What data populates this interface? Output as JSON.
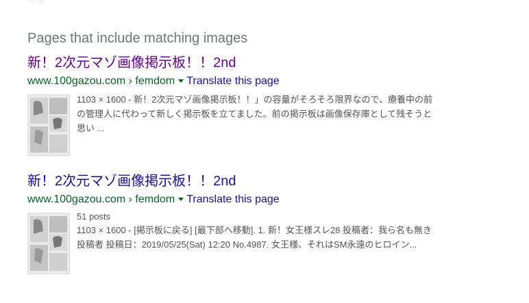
{
  "top_fragment": "... ...",
  "section_title": "Pages that include matching images",
  "results": [
    {
      "title": "新！2次元マゾ画像掲示板！！2nd",
      "url": "www.100gazou.com › femdom",
      "translate": "Translate this page",
      "posts": "",
      "snippet": "1103 × 1600 - 新！2次元マゾ画像掲示板！！」の容量がそろそろ限界なので、療養中の前の管理人に代わって新しく掲示板を立てました。前の掲示板は画像保存庫として残そうと思い ..."
    },
    {
      "title": "新！2次元マゾ画像掲示板！！2nd",
      "url": "www.100gazou.com › femdom",
      "translate": "Translate this page",
      "posts": "51 posts",
      "snippet": "1103 × 1600 - [掲示板に戻る] [最下部へ移動]. 1. 新！女王様スレ28 投稿者：我ら名も無き投稿者 投稿日：2019/05/25(Sat) 12:20 No.4987. 女王様、それはSM永遠のヒロイン..."
    }
  ],
  "colors": {
    "visited": "#660099",
    "link": "#1a0dab",
    "url": "#006621",
    "snippet": "#545454"
  },
  "icons": {
    "dropdown": "triangle-down-icon"
  }
}
